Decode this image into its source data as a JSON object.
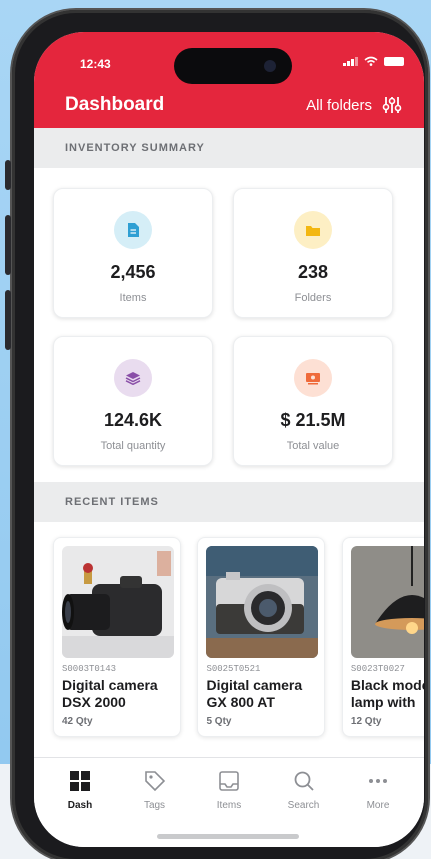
{
  "status": {
    "time": "12:43"
  },
  "header": {
    "title": "Dashboard",
    "filter_label": "All folders"
  },
  "summary": {
    "section_title": "INVENTORY SUMMARY",
    "cards": [
      {
        "value": "2,456",
        "label": "Items",
        "icon": "document-icon",
        "color": "#d5eef7"
      },
      {
        "value": "238",
        "label": "Folders",
        "icon": "folder-icon",
        "color": "#fdefc4"
      },
      {
        "value": "124.6K",
        "label": "Total quantity",
        "icon": "layers-icon",
        "color": "#e9dcef"
      },
      {
        "value": "$ 21.5M",
        "label": "Total value",
        "icon": "money-icon",
        "color": "#fde0d4"
      }
    ]
  },
  "recent": {
    "section_title": "RECENT ITEMS",
    "items": [
      {
        "sku": "S0003T0143",
        "name": "Digital camera DSX 2000",
        "qty": "42 Qty"
      },
      {
        "sku": "S0025T0521",
        "name": "Digital camera GX 800 AT",
        "qty": "5 Qty"
      },
      {
        "sku": "S0023T0027",
        "name": "Black modern lamp with",
        "qty": "12 Qty"
      }
    ]
  },
  "tabs": [
    {
      "label": "Dash",
      "icon": "grid-icon",
      "active": true
    },
    {
      "label": "Tags",
      "icon": "tag-icon",
      "active": false
    },
    {
      "label": "Items",
      "icon": "inbox-icon",
      "active": false
    },
    {
      "label": "Search",
      "icon": "search-icon",
      "active": false
    },
    {
      "label": "More",
      "icon": "more-icon",
      "active": false
    }
  ]
}
